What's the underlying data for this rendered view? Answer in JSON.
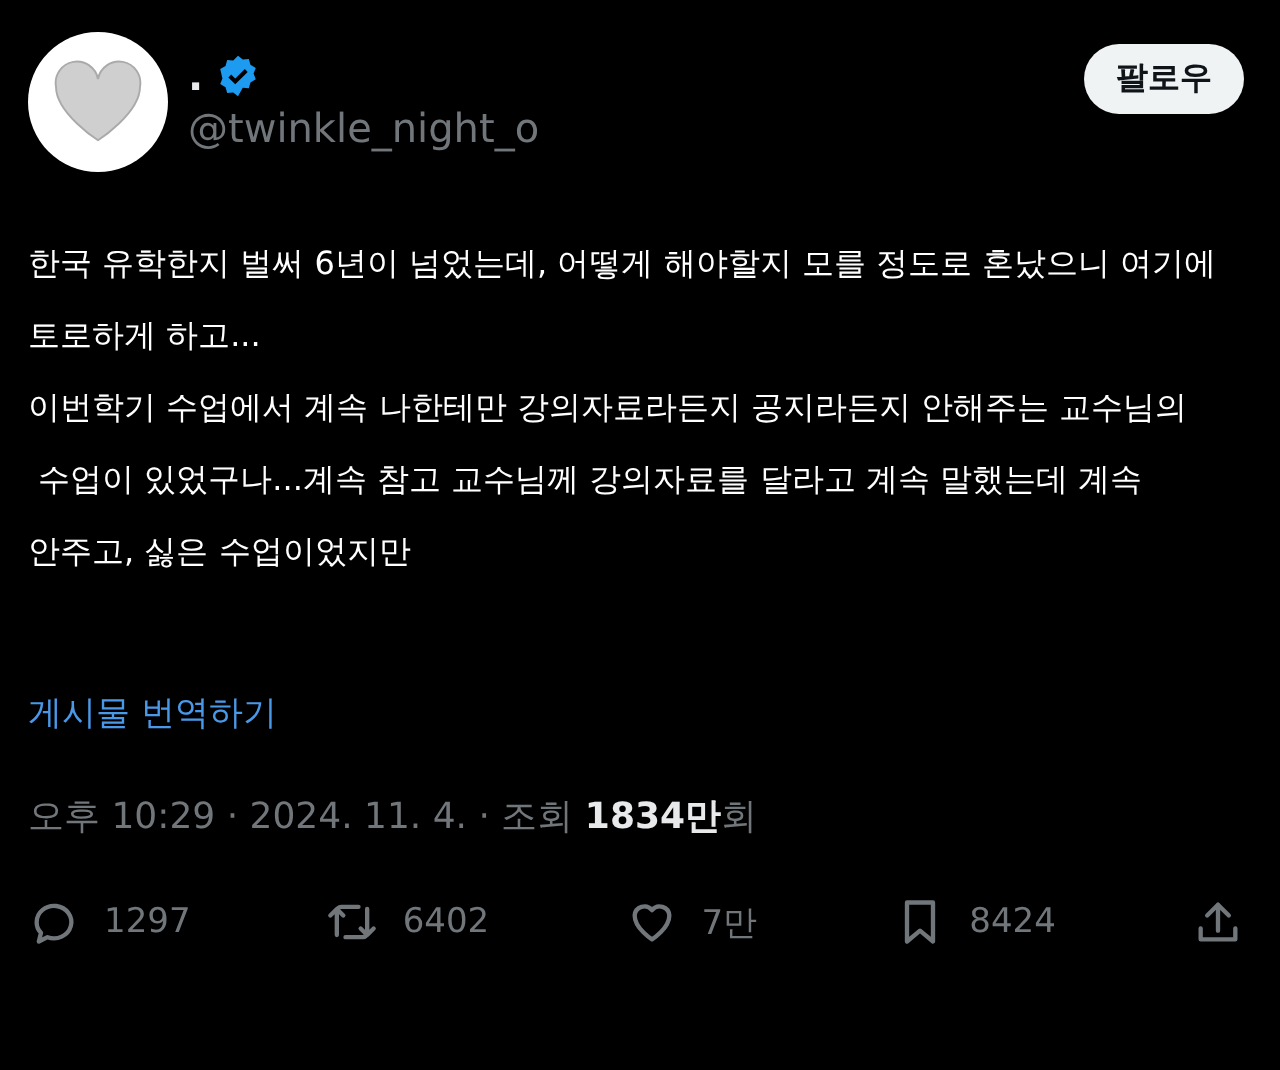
{
  "author": {
    "name": ".",
    "verified": true,
    "handle": "@twinkle_night_o"
  },
  "follow_button": "팔로우",
  "body_lines": [
    "한국 유학한지 벌써 6년이 넘었는데, 어떻게 해야할지 모를 정도로 혼났으니 여기에",
    "토로하게 하고...",
    "이번학기 수업에서 계속 나한테만 강의자료라든지 공지라든지 안해주는 교수님의",
    " 수업이 있었구나...계속 참고 교수님께 강의자료를 달라고 계속 말했는데 계속",
    "안주고, 싫은 수업이었지만"
  ],
  "translate_link": "게시물 번역하기",
  "meta": "오후 10:29 · 2024. 11. 4. · 조회 **1834만**회",
  "actions": [
    {
      "kind": "reply",
      "count": "1297"
    },
    {
      "kind": "repost",
      "count": "6402"
    },
    {
      "kind": "like",
      "count": "7만"
    },
    {
      "kind": "bookmark",
      "count": "8424"
    },
    {
      "kind": "share"
    }
  ]
}
